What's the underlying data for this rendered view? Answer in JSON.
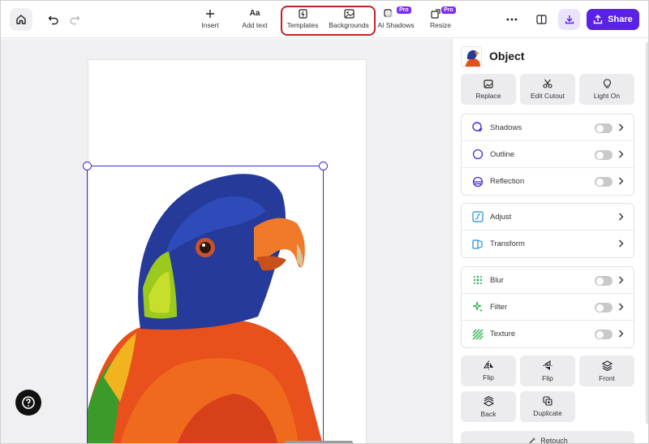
{
  "toolbar": {
    "tools": [
      {
        "label": "Insert",
        "icon": "plus-icon"
      },
      {
        "label": "Add text",
        "icon": "text-aa-icon"
      },
      {
        "label": "Templates",
        "icon": "template-icon"
      },
      {
        "label": "Backgrounds",
        "icon": "background-image-icon"
      },
      {
        "label": "AI Shadows",
        "icon": "ai-shadow-icon",
        "badge": "Pro"
      },
      {
        "label": "Resize",
        "icon": "resize-icon",
        "badge": "Pro"
      }
    ],
    "share_label": "Share",
    "accent": "#5b21e6",
    "highlight_color": "#c62024"
  },
  "panel": {
    "title": "Object",
    "top_actions": [
      {
        "label": "Replace",
        "icon": "replace-image-icon"
      },
      {
        "label": "Edit Cutout",
        "icon": "scissors-icon"
      },
      {
        "label": "Light On",
        "icon": "lightbulb-icon"
      }
    ],
    "effects": [
      {
        "label": "Shadows",
        "icon": "shadow-icon",
        "enabled": false
      },
      {
        "label": "Outline",
        "icon": "outline-icon",
        "enabled": false
      },
      {
        "label": "Reflection",
        "icon": "reflection-icon",
        "enabled": false
      }
    ],
    "adjustments": [
      {
        "label": "Adjust",
        "icon": "adjust-icon"
      },
      {
        "label": "Transform",
        "icon": "transform-icon"
      }
    ],
    "filters": [
      {
        "label": "Blur",
        "icon": "blur-icon",
        "enabled": false
      },
      {
        "label": "Filter",
        "icon": "sparkle-icon",
        "enabled": false
      },
      {
        "label": "Texture",
        "icon": "texture-icon",
        "enabled": false
      }
    ],
    "arrange_actions": [
      {
        "label": "Flip",
        "icon": "flip-horizontal-icon"
      },
      {
        "label": "Flip",
        "icon": "flip-vertical-icon"
      },
      {
        "label": "Front",
        "icon": "bring-front-icon"
      },
      {
        "label": "Back",
        "icon": "send-back-icon"
      },
      {
        "label": "Duplicate",
        "icon": "duplicate-icon"
      }
    ],
    "retouch_label": "Retouch"
  }
}
